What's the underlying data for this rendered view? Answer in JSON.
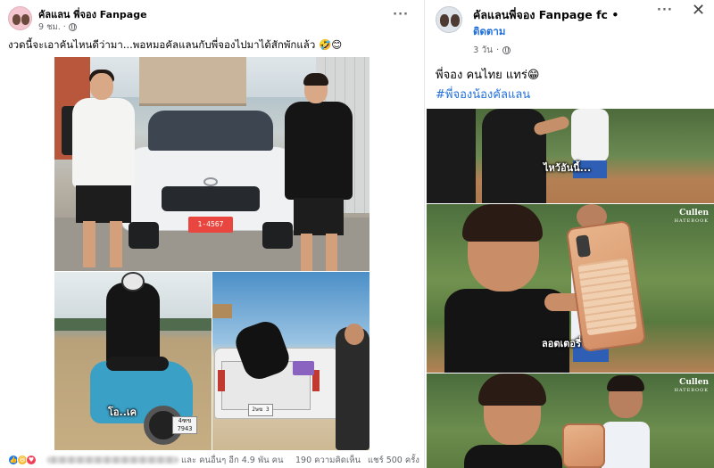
{
  "left_post": {
    "page_name": "คัลแลน พี่จอง Fanpage",
    "time": "9 ชม.",
    "caption": "งวดนี้จะเอาคันไหนดีว่ามา...พอหมอคัลแลนกับพี่จองไปมาได้สักพักแล้ว 🤣😊",
    "car_plate": "1-4567",
    "bike_subtitle": "โอ..เค",
    "bike_plate": "4ฑข 7943",
    "truck_plate": "2ษฆ 3",
    "reactions": [
      "like",
      "haha",
      "love"
    ],
    "reactions_others": "และ คนอื่นๆ อีก 4.9 พัน คน",
    "comments": "190 ความคิดเห็น",
    "shares": "แชร์ 500 ครั้ง"
  },
  "right_post": {
    "page_name": "คัลแลนพี่จอง Fanpage fc",
    "dot": "•",
    "follow_label": "ติดตาม",
    "time": "3 วัน",
    "text": "พี่จอง คนไทย แทร่😁",
    "hashtag": "#พี่จองน้องคัลแลน",
    "video1_subtitle": "ไหว้อันนี้...",
    "video2_subtitle": "ลอตเตอรี่",
    "watermark": "Cullen",
    "watermark_sub": "HATEBOOK"
  },
  "icons": {
    "more": "more-icon",
    "close": "close-icon",
    "globe": "globe-icon"
  }
}
